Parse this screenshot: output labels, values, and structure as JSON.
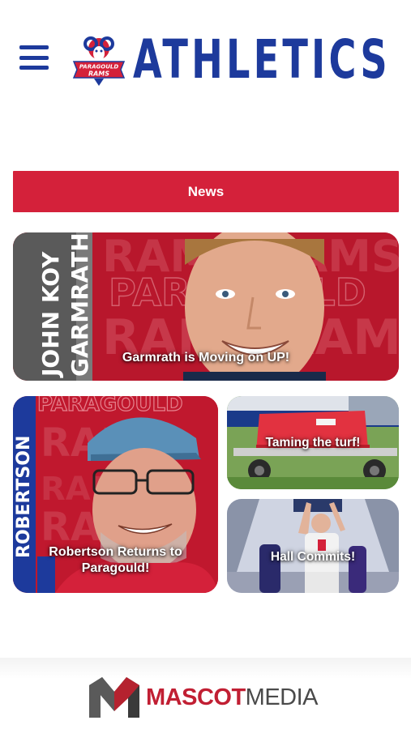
{
  "header": {
    "title": "ATHLETICS",
    "logo_text": "PARAGOULD RAMS",
    "menu_icon": "hamburger-menu-icon"
  },
  "news": {
    "label": "News"
  },
  "stories": [
    {
      "title": "Garmrath is Moving on UP!",
      "bg_name": "JOHN KOY GARMRATH",
      "bg_words": [
        "RAMS",
        "PARAGOULD"
      ]
    },
    {
      "title": "Robertson Returns to Paragould!",
      "bg_name": "ROBERTSON",
      "bg_words": [
        "RAMS",
        "PARAGOULD"
      ]
    },
    {
      "title": "Taming the turf!"
    },
    {
      "title": "Hall Commits!"
    }
  ],
  "footer": {
    "brand_a": "MASCOT",
    "brand_b": "MEDIA"
  },
  "colors": {
    "brand_blue": "#1d3a9c",
    "brand_red": "#d4213a"
  }
}
